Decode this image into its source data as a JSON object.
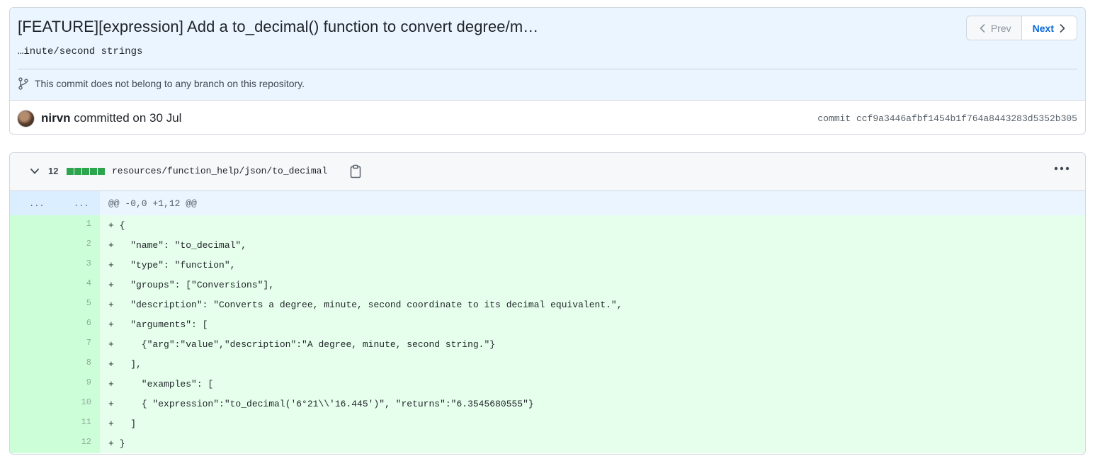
{
  "commit": {
    "title": "[FEATURE][expression] Add a to_decimal() function to convert degree/m…",
    "description": "…inute/second strings",
    "branch_note": "This commit does not belong to any branch on this repository.",
    "author": "nirvn",
    "committed_text": "committed on 30 Jul",
    "sha_label": "commit",
    "sha": "ccf9a3446afbf1454b1f764a8443283d5352b305",
    "nav": {
      "prev": "Prev",
      "next": "Next"
    }
  },
  "file": {
    "changes": "12",
    "path": "resources/function_help/json/to_decimal",
    "hunk": {
      "old_marker": "...",
      "new_marker": "...",
      "header": "@@ -0,0 +1,12 @@"
    },
    "lines": [
      {
        "num": "1",
        "code": "+ {"
      },
      {
        "num": "2",
        "code": "+   \"name\": \"to_decimal\","
      },
      {
        "num": "3",
        "code": "+   \"type\": \"function\","
      },
      {
        "num": "4",
        "code": "+   \"groups\": [\"Conversions\"],"
      },
      {
        "num": "5",
        "code": "+   \"description\": \"Converts a degree, minute, second coordinate to its decimal equivalent.\","
      },
      {
        "num": "6",
        "code": "+   \"arguments\": ["
      },
      {
        "num": "7",
        "code": "+     {\"arg\":\"value\",\"description\":\"A degree, minute, second string.\"}"
      },
      {
        "num": "8",
        "code": "+   ],"
      },
      {
        "num": "9",
        "code": "+     \"examples\": ["
      },
      {
        "num": "10",
        "code": "+     { \"expression\":\"to_decimal('6°21\\\\'16.445')\", \"returns\":\"6.3545680555\"}"
      },
      {
        "num": "11",
        "code": "+   ]"
      },
      {
        "num": "12",
        "code": "+ }"
      }
    ]
  },
  "colors": {
    "header_bg": "#eaf5ff",
    "added_line_bg": "#e6ffec",
    "added_gutter_bg": "#ccffd8",
    "diffstat_green": "#2da44e",
    "link_blue": "#0969da"
  }
}
